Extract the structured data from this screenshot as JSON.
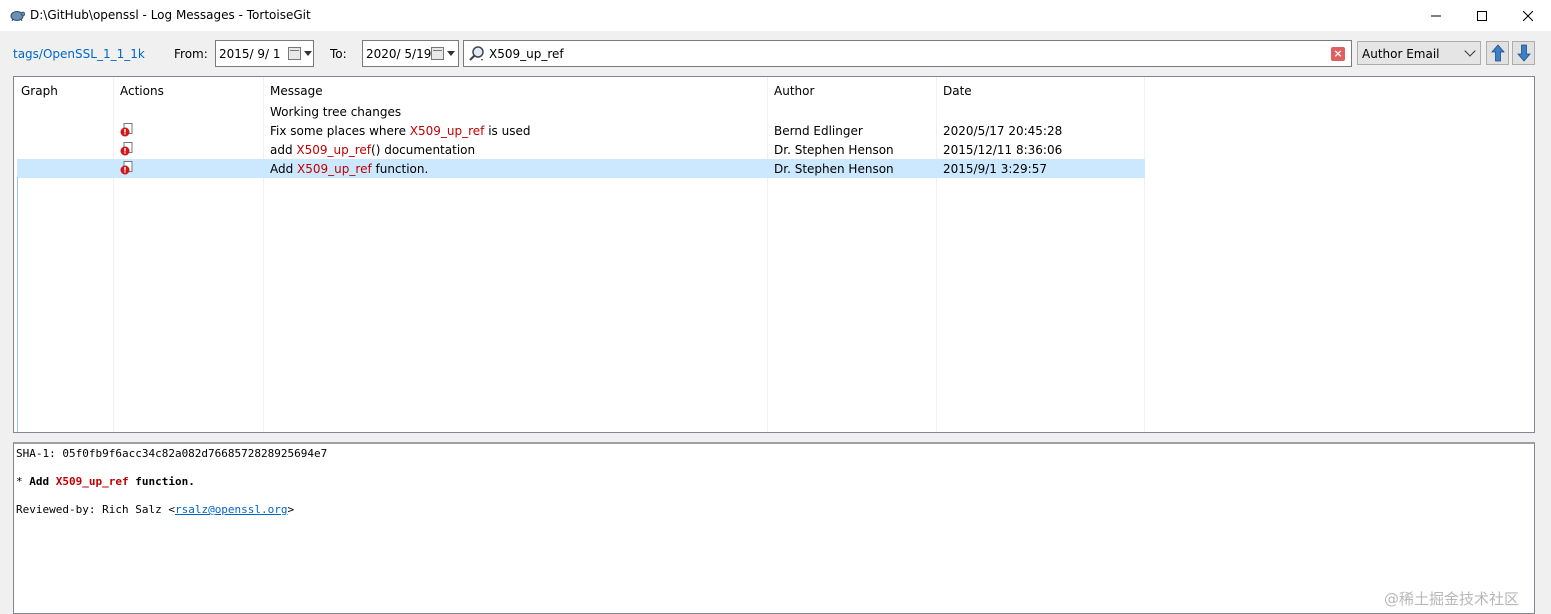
{
  "window": {
    "title": "D:\\GitHub\\openssl - Log Messages - TortoiseGit",
    "icon": "tortoise-icon"
  },
  "toolbar": {
    "branch": "tags/OpenSSL_1_1_1k",
    "from_label": "From:",
    "from_value": "2015/  9/  1",
    "to_label": "To:",
    "to_value": "2020/  5/19",
    "search_value": "X509_up_ref",
    "filter_selected": "Author Email"
  },
  "log": {
    "columns": [
      "Graph",
      "Actions",
      "Message",
      "Author",
      "Date"
    ],
    "working_tree": "Working tree changes",
    "rows": [
      {
        "msg_before": "Fix some places where ",
        "msg_match": "X509_up_ref",
        "msg_after": " is used",
        "author": "Bernd Edlinger",
        "date": "2020/5/17 20:45:28",
        "selected": false
      },
      {
        "msg_before": "add ",
        "msg_match": "X509_up_ref",
        "msg_after": "() documentation",
        "author": "Dr. Stephen Henson",
        "date": "2015/12/11 8:36:06",
        "selected": false
      },
      {
        "msg_before": "Add ",
        "msg_match": "X509_up_ref",
        "msg_after": " function.",
        "author": "Dr. Stephen Henson",
        "date": "2015/9/1 3:29:57",
        "selected": true
      }
    ]
  },
  "details": {
    "sha": "SHA-1: 05f0fb9f6acc34c82a082d7668572828925694e7",
    "bullet": "* ",
    "msg_before": "Add ",
    "msg_match": "X509_up_ref",
    "msg_after": " function.",
    "reviewed_prefix": "Reviewed-by: Rich Salz <",
    "reviewed_email": "rsalz@openssl.org",
    "reviewed_suffix": ">"
  },
  "watermark": "@稀土掘金技术社区",
  "colors": {
    "highlight": "#c00000",
    "selection": "#cce8ff",
    "link": "#0066cc"
  }
}
